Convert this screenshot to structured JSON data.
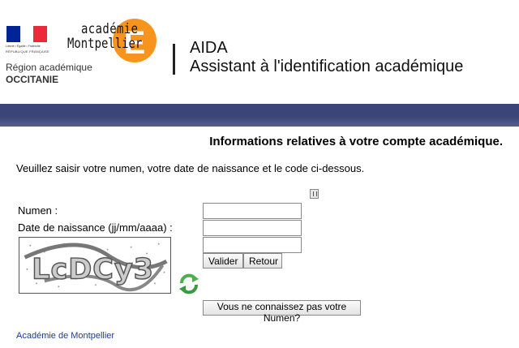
{
  "header": {
    "flag_motto": "Liberté • Égalité • Fraternité",
    "flag_country": "RÉPUBLIQUE FRANÇAISE",
    "academy_word": "académie",
    "academy_city": "Montpellier",
    "region_line1": "Région académique",
    "region_line2": "OCCITANIE",
    "app_name": "AIDA",
    "app_full_name": "Assistant à l'identification académique"
  },
  "colors": {
    "banner": "#3c4576",
    "logo_orange": "#f7941d",
    "flag_blue": "#002395",
    "flag_red": "#ed2939",
    "link": "#1d3d8f",
    "refresh_green": "#4caf50"
  },
  "main": {
    "title": "Informations relatives à votre compte académique.",
    "instructions": "Veuillez saisir votre numen, votre date de naissance et le code ci-dessous.",
    "numen_label": "Numen :",
    "numen_value": "",
    "dob_label": "Date de naissance (jj/mm/aaaa) :",
    "dob_value": "",
    "captcha_value": "",
    "captcha_text": "LcDCy3",
    "validate_label": "Valider",
    "back_label": "Retour",
    "forgot_label": "Vous ne connaissez pas votre Numen?",
    "help_icon": "help-icon",
    "refresh_icon": "refresh-icon"
  },
  "footer": {
    "link_text": "Académie de Montpellier"
  }
}
